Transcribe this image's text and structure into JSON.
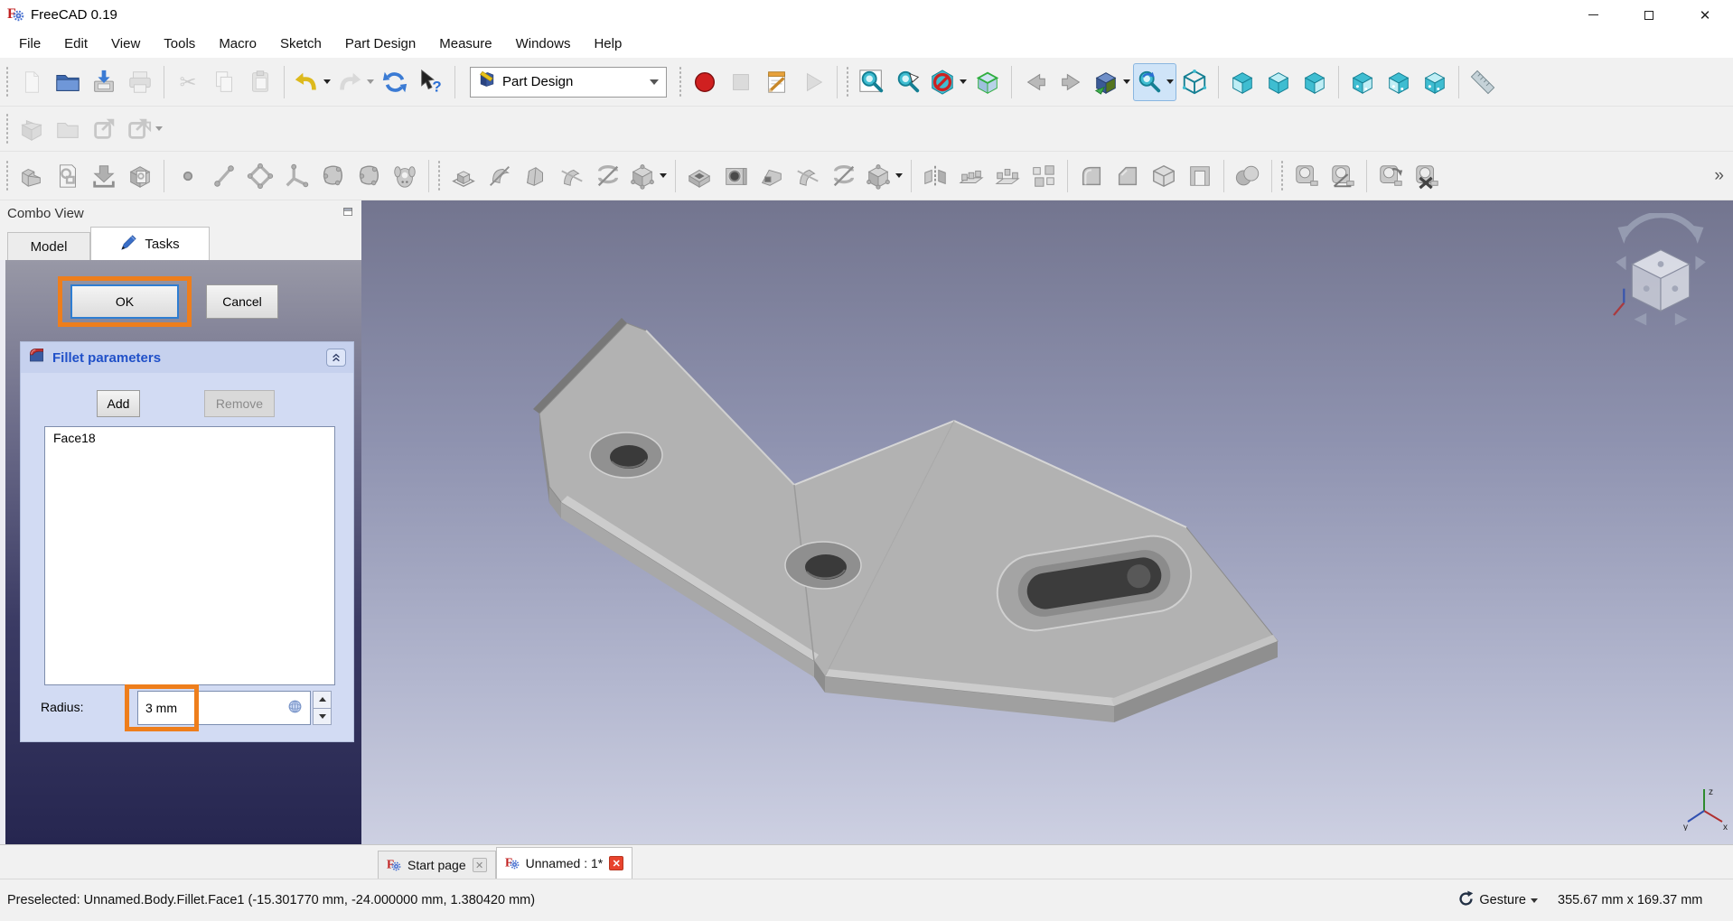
{
  "window": {
    "title": "FreeCAD 0.19"
  },
  "menu": {
    "items": [
      "File",
      "Edit",
      "View",
      "Tools",
      "Macro",
      "Sketch",
      "Part Design",
      "Measure",
      "Windows",
      "Help"
    ]
  },
  "workbench_selector": {
    "value": "Part Design"
  },
  "toolbars": {
    "row1a": [
      {
        "grip": true
      },
      {
        "name": "new-file-button",
        "kind": "page",
        "disabled": true
      },
      {
        "name": "open-file-button",
        "kind": "folder"
      },
      {
        "name": "save-button",
        "kind": "save"
      },
      {
        "name": "print-button",
        "kind": "printer",
        "disabled": true
      },
      {
        "sep": true
      },
      {
        "name": "cut-button",
        "kind": "scissors",
        "disabled": true
      },
      {
        "name": "copy-button",
        "kind": "copy",
        "disabled": true
      },
      {
        "name": "paste-button",
        "kind": "paste",
        "disabled": true
      },
      {
        "sep": true
      },
      {
        "name": "undo-button",
        "kind": "undo",
        "dropdown": true
      },
      {
        "name": "redo-button",
        "kind": "redo",
        "disabled": true,
        "dropdown": true
      },
      {
        "name": "refresh-button",
        "kind": "refresh"
      },
      {
        "name": "whats-this-button",
        "kind": "cursor-help"
      }
    ],
    "row1b": [
      {
        "grip": true
      },
      {
        "name": "macro-record-button",
        "kind": "record"
      },
      {
        "name": "macro-stop-button",
        "kind": "stop",
        "disabled": true
      },
      {
        "name": "macro-edit-button",
        "kind": "notepad"
      },
      {
        "name": "macro-play-button",
        "kind": "play",
        "disabled": true
      },
      {
        "sep": true
      },
      {
        "grip": true
      },
      {
        "name": "zoom-fit-all-button",
        "kind": "mag-fit"
      },
      {
        "name": "zoom-selection-button",
        "kind": "mag-arrow"
      },
      {
        "name": "clipping-plane-button",
        "kind": "no-sign",
        "dropdown": true
      },
      {
        "name": "axonometric-view-button",
        "kind": "cube-green"
      },
      {
        "sep": true
      },
      {
        "name": "nav-back-button",
        "kind": "arrow-left"
      },
      {
        "name": "nav-forward-button",
        "kind": "arrow-right"
      },
      {
        "name": "linked-view-button",
        "kind": "cube-arrow",
        "dropdown": true
      },
      {
        "name": "sync-view-button",
        "kind": "mag-sync",
        "dropdown": true,
        "active": true
      },
      {
        "name": "isometric-view-button",
        "kind": "cube-wire"
      },
      {
        "sep": true
      },
      {
        "name": "view-front-button",
        "kind": "cube-front"
      },
      {
        "name": "view-top-button",
        "kind": "cube-top"
      },
      {
        "name": "view-right-button",
        "kind": "cube-right"
      },
      {
        "sep": true
      },
      {
        "name": "view-rear-button",
        "kind": "cube-rear"
      },
      {
        "name": "view-bottom-button",
        "kind": "cube-bottom"
      },
      {
        "name": "view-left-button",
        "kind": "cube-left"
      },
      {
        "sep": true
      },
      {
        "name": "measure-distance-button",
        "kind": "ruler"
      }
    ],
    "row2": [
      {
        "grip": true
      },
      {
        "name": "create-part-button",
        "kind": "gray-part",
        "disabled": true
      },
      {
        "name": "create-group-button",
        "kind": "gray-folder",
        "disabled": true
      },
      {
        "name": "make-link-button",
        "kind": "gray-link",
        "disabled": true
      },
      {
        "name": "make-link-group-button",
        "kind": "gray-link2",
        "disabled": true,
        "dropdown": true
      }
    ],
    "row3": [
      {
        "grip": true
      },
      {
        "name": "create-body-button",
        "kind": "gray-body"
      },
      {
        "name": "create-sketch-button",
        "kind": "gray-sketch"
      },
      {
        "name": "map-sketch-button",
        "kind": "gray-map-sketch"
      },
      {
        "name": "edit-sketch-button",
        "kind": "gray-validate-sketch"
      },
      {
        "sep": true
      },
      {
        "name": "datum-point-button",
        "kind": "gray-point"
      },
      {
        "name": "datum-line-button",
        "kind": "gray-line"
      },
      {
        "name": "datum-plane-button",
        "kind": "gray-plane"
      },
      {
        "name": "datum-coordinate-system-button",
        "kind": "gray-axes"
      },
      {
        "name": "shape-binder-button",
        "kind": "gray-blob"
      },
      {
        "name": "sub-shape-binder-button",
        "kind": "gray-blob"
      },
      {
        "name": "clone-button",
        "kind": "gray-sheep"
      },
      {
        "sep": true
      },
      {
        "grip": true
      },
      {
        "name": "pad-button",
        "kind": "gray-pad"
      },
      {
        "name": "revolution-button",
        "kind": "gray-revolve"
      },
      {
        "name": "additive-loft-button",
        "kind": "gray-loft"
      },
      {
        "name": "additive-pipe-button",
        "kind": "gray-sweep"
      },
      {
        "name": "additive-helix-button",
        "kind": "gray-helix"
      },
      {
        "name": "additive-primitive-button",
        "kind": "gray-cube-points",
        "dropdown": true
      },
      {
        "sep": true
      },
      {
        "name": "pocket-button",
        "kind": "gray-pocket"
      },
      {
        "name": "hole-button",
        "kind": "gray-hole"
      },
      {
        "name": "groove-button",
        "kind": "gray-groove"
      },
      {
        "name": "subtractive-pipe-button",
        "kind": "gray-sweep"
      },
      {
        "name": "subtractive-helix-button",
        "kind": "gray-helix"
      },
      {
        "name": "subtractive-primitive-button",
        "kind": "gray-cube-points",
        "dropdown": true
      },
      {
        "sep": true
      },
      {
        "name": "mirrored-button",
        "kind": "gray-mirror"
      },
      {
        "name": "linear-pattern-button",
        "kind": "gray-pattern"
      },
      {
        "name": "polar-pattern-button",
        "kind": "gray-pattern2"
      },
      {
        "name": "multi-transform-button",
        "kind": "gray-multitransform"
      },
      {
        "sep": true
      },
      {
        "name": "fillet-button",
        "kind": "gray-fillet"
      },
      {
        "name": "chamfer-button",
        "kind": "gray-chamfer"
      },
      {
        "name": "draft-button",
        "kind": "gray-draft"
      },
      {
        "name": "thickness-button",
        "kind": "gray-thickness"
      },
      {
        "sep": true
      },
      {
        "name": "boolean-operation-button",
        "kind": "gray-spheres"
      },
      {
        "sep": true
      },
      {
        "grip": true
      },
      {
        "name": "measure-linear-button",
        "kind": "gray-tape"
      },
      {
        "name": "measure-angular-button",
        "kind": "gray-tape-angle"
      },
      {
        "sep": true
      },
      {
        "name": "measure-refresh-button",
        "kind": "gray-tape-refresh"
      },
      {
        "name": "measure-clear-button",
        "kind": "gray-tape-clear"
      }
    ]
  },
  "combo_view": {
    "title": "Combo View",
    "tabs": {
      "model": "Model",
      "tasks": "Tasks"
    },
    "ok_label": "OK",
    "cancel_label": "Cancel",
    "fillet": {
      "title": "Fillet parameters",
      "add_label": "Add",
      "remove_label": "Remove",
      "faces": [
        "Face18"
      ],
      "radius_label": "Radius:",
      "radius_value": "3 mm"
    }
  },
  "doc_tabs": [
    {
      "label": "Start page"
    },
    {
      "label": "Unnamed : 1*"
    }
  ],
  "status_bar": {
    "preselected": "Preselected: Unnamed.Body.Fillet.Face1 (-15.301770 mm, -24.000000 mm, 1.380420 mm)",
    "nav_style": "Gesture",
    "dimensions": "355.67 mm x 169.37 mm"
  },
  "icons": {
    "app_logo": "freecad-logo-icon",
    "tasks_tab": "pencil-icon",
    "fillet_header": "fillet-icon",
    "collapse": "collapse-chevrons-icon",
    "radius_field": "expression-globe-icon",
    "gesture": "gesture-icon",
    "doc_tab": "freecad-icon",
    "viewport_widget": "navigation-cube",
    "axis_cross": "axis-cross-icon"
  },
  "colors": {
    "annotation_orange": "#ee7e1c",
    "accent_blue": "#2d7dd2",
    "panel_navy": "#262650",
    "viewport_top": "#73758f",
    "viewport_bottom": "#cdd0e2"
  }
}
